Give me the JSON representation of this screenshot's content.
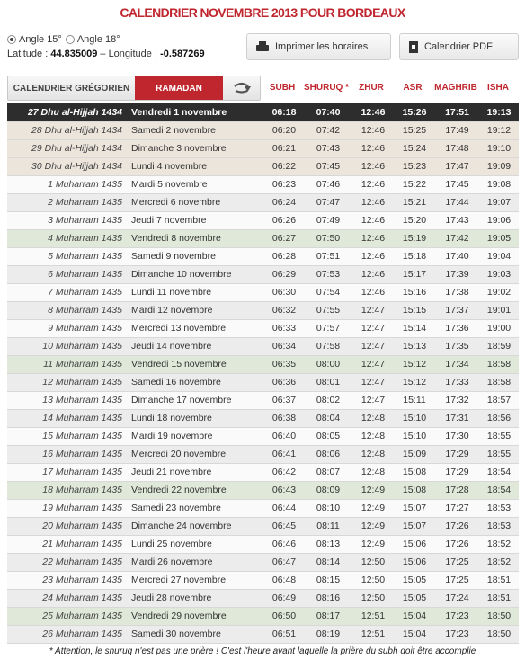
{
  "title": "CALENDRIER NOVEMBRE 2013 POUR BORDEAUX",
  "angles": [
    {
      "label": "Angle 15°",
      "selected": true
    },
    {
      "label": "Angle 18°",
      "selected": false
    }
  ],
  "coords": {
    "lat_label": "Latitude : ",
    "lat_value": "44.835009",
    "sep": " – ",
    "lon_label": "Longitude : ",
    "lon_value": "-0.587269"
  },
  "buttons": {
    "print": {
      "label": "Imprimer les horaires",
      "icon": "printer-icon"
    },
    "pdf": {
      "label": "Calendrier PDF",
      "icon": "pdf-file-icon"
    }
  },
  "tabs": {
    "gregorian": "CALENDRIER GRÉGORIEN",
    "ramadan": "RAMADAN",
    "toggle_icon": "swap-arrow-icon"
  },
  "columns": [
    "SUBH",
    "SHURUQ *",
    "ZHUR",
    "ASR",
    "MAGHRIB",
    "ISHA"
  ],
  "rows": [
    {
      "hijri": "27 Dhu al-Hijjah 1434",
      "day": "Vendredi 1 novembre",
      "times": [
        "06:18",
        "07:40",
        "12:46",
        "15:26",
        "17:51",
        "19:13"
      ],
      "style": "cur"
    },
    {
      "hijri": "28 Dhu al-Hijjah 1434",
      "day": "Samedi 2 novembre",
      "times": [
        "06:20",
        "07:42",
        "12:46",
        "15:25",
        "17:49",
        "19:12"
      ],
      "style": "r3"
    },
    {
      "hijri": "29 Dhu al-Hijjah 1434",
      "day": "Dimanche 3 novembre",
      "times": [
        "06:21",
        "07:43",
        "12:46",
        "15:24",
        "17:48",
        "19:10"
      ],
      "style": "r3"
    },
    {
      "hijri": "30 Dhu al-Hijjah 1434",
      "day": "Lundi 4 novembre",
      "times": [
        "06:22",
        "07:45",
        "12:46",
        "15:23",
        "17:47",
        "19:09"
      ],
      "style": "r3"
    },
    {
      "hijri": "1 Muharram 1435",
      "day": "Mardi 5 novembre",
      "times": [
        "06:23",
        "07:46",
        "12:46",
        "15:22",
        "17:45",
        "19:08"
      ],
      "style": "r0"
    },
    {
      "hijri": "2 Muharram 1435",
      "day": "Mercredi 6 novembre",
      "times": [
        "06:24",
        "07:47",
        "12:46",
        "15:21",
        "17:44",
        "19:07"
      ],
      "style": "r1"
    },
    {
      "hijri": "3 Muharram 1435",
      "day": "Jeudi 7 novembre",
      "times": [
        "06:26",
        "07:49",
        "12:46",
        "15:20",
        "17:43",
        "19:06"
      ],
      "style": "r0"
    },
    {
      "hijri": "4 Muharram 1435",
      "day": "Vendredi 8 novembre",
      "times": [
        "06:27",
        "07:50",
        "12:46",
        "15:19",
        "17:42",
        "19:05"
      ],
      "style": "r2"
    },
    {
      "hijri": "5 Muharram 1435",
      "day": "Samedi 9 novembre",
      "times": [
        "06:28",
        "07:51",
        "12:46",
        "15:18",
        "17:40",
        "19:04"
      ],
      "style": "r0"
    },
    {
      "hijri": "6 Muharram 1435",
      "day": "Dimanche 10 novembre",
      "times": [
        "06:29",
        "07:53",
        "12:46",
        "15:17",
        "17:39",
        "19:03"
      ],
      "style": "r1"
    },
    {
      "hijri": "7 Muharram 1435",
      "day": "Lundi 11 novembre",
      "times": [
        "06:30",
        "07:54",
        "12:46",
        "15:16",
        "17:38",
        "19:02"
      ],
      "style": "r0"
    },
    {
      "hijri": "8 Muharram 1435",
      "day": "Mardi 12 novembre",
      "times": [
        "06:32",
        "07:55",
        "12:47",
        "15:15",
        "17:37",
        "19:01"
      ],
      "style": "r1"
    },
    {
      "hijri": "9 Muharram 1435",
      "day": "Mercredi 13 novembre",
      "times": [
        "06:33",
        "07:57",
        "12:47",
        "15:14",
        "17:36",
        "19:00"
      ],
      "style": "r0"
    },
    {
      "hijri": "10 Muharram 1435",
      "day": "Jeudi 14 novembre",
      "times": [
        "06:34",
        "07:58",
        "12:47",
        "15:13",
        "17:35",
        "18:59"
      ],
      "style": "r1"
    },
    {
      "hijri": "11 Muharram 1435",
      "day": "Vendredi 15 novembre",
      "times": [
        "06:35",
        "08:00",
        "12:47",
        "15:12",
        "17:34",
        "18:58"
      ],
      "style": "r2"
    },
    {
      "hijri": "12 Muharram 1435",
      "day": "Samedi 16 novembre",
      "times": [
        "06:36",
        "08:01",
        "12:47",
        "15:12",
        "17:33",
        "18:58"
      ],
      "style": "r1"
    },
    {
      "hijri": "13 Muharram 1435",
      "day": "Dimanche 17 novembre",
      "times": [
        "06:37",
        "08:02",
        "12:47",
        "15:11",
        "17:32",
        "18:57"
      ],
      "style": "r0"
    },
    {
      "hijri": "14 Muharram 1435",
      "day": "Lundi 18 novembre",
      "times": [
        "06:38",
        "08:04",
        "12:48",
        "15:10",
        "17:31",
        "18:56"
      ],
      "style": "r1"
    },
    {
      "hijri": "15 Muharram 1435",
      "day": "Mardi 19 novembre",
      "times": [
        "06:40",
        "08:05",
        "12:48",
        "15:10",
        "17:30",
        "18:55"
      ],
      "style": "r0"
    },
    {
      "hijri": "16 Muharram 1435",
      "day": "Mercredi 20 novembre",
      "times": [
        "06:41",
        "08:06",
        "12:48",
        "15:09",
        "17:29",
        "18:55"
      ],
      "style": "r1"
    },
    {
      "hijri": "17 Muharram 1435",
      "day": "Jeudi 21 novembre",
      "times": [
        "06:42",
        "08:07",
        "12:48",
        "15:08",
        "17:29",
        "18:54"
      ],
      "style": "r0"
    },
    {
      "hijri": "18 Muharram 1435",
      "day": "Vendredi 22 novembre",
      "times": [
        "06:43",
        "08:09",
        "12:49",
        "15:08",
        "17:28",
        "18:54"
      ],
      "style": "r2"
    },
    {
      "hijri": "19 Muharram 1435",
      "day": "Samedi 23 novembre",
      "times": [
        "06:44",
        "08:10",
        "12:49",
        "15:07",
        "17:27",
        "18:53"
      ],
      "style": "r0"
    },
    {
      "hijri": "20 Muharram 1435",
      "day": "Dimanche 24 novembre",
      "times": [
        "06:45",
        "08:11",
        "12:49",
        "15:07",
        "17:26",
        "18:53"
      ],
      "style": "r1"
    },
    {
      "hijri": "21 Muharram 1435",
      "day": "Lundi 25 novembre",
      "times": [
        "06:46",
        "08:13",
        "12:49",
        "15:06",
        "17:26",
        "18:52"
      ],
      "style": "r0"
    },
    {
      "hijri": "22 Muharram 1435",
      "day": "Mardi 26 novembre",
      "times": [
        "06:47",
        "08:14",
        "12:50",
        "15:06",
        "17:25",
        "18:52"
      ],
      "style": "r1"
    },
    {
      "hijri": "23 Muharram 1435",
      "day": "Mercredi 27 novembre",
      "times": [
        "06:48",
        "08:15",
        "12:50",
        "15:05",
        "17:25",
        "18:51"
      ],
      "style": "r0"
    },
    {
      "hijri": "24 Muharram 1435",
      "day": "Jeudi 28 novembre",
      "times": [
        "06:49",
        "08:16",
        "12:50",
        "15:05",
        "17:24",
        "18:51"
      ],
      "style": "r1"
    },
    {
      "hijri": "25 Muharram 1435",
      "day": "Vendredi 29 novembre",
      "times": [
        "06:50",
        "08:17",
        "12:51",
        "15:04",
        "17:23",
        "18:50"
      ],
      "style": "r2"
    },
    {
      "hijri": "26 Muharram 1435",
      "day": "Samedi 30 novembre",
      "times": [
        "06:51",
        "08:19",
        "12:51",
        "15:04",
        "17:23",
        "18:50"
      ],
      "style": "r1"
    }
  ],
  "note": "* Attention, le shuruq n'est pas une prière ! C'est l'heure avant laquelle la prière du subh doit être accomplie"
}
